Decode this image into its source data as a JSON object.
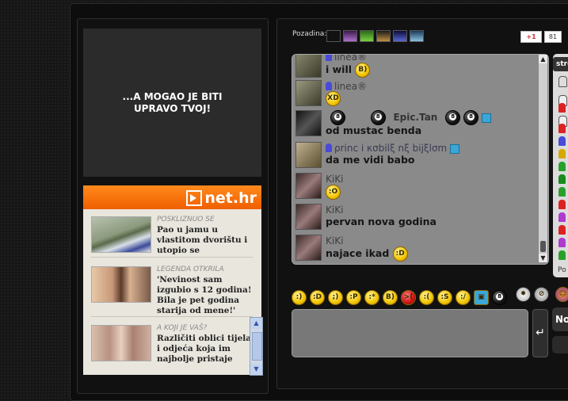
{
  "ad": {
    "text": "...A MOGAO JE BITI\nUPRAVO TVOJ!"
  },
  "news": {
    "logo": "net.hr",
    "items": [
      {
        "category": "POSKLIZNUO SE",
        "title": "Pao u jamu u vlastitom dvorištu i utopio se"
      },
      {
        "category": "LEGENDA OTKRILA",
        "title": "'Nevinost sam izgubio s 12 godina! Bila je pet godina starija od mene!'"
      },
      {
        "category": "A KOJI JE VAŠ?",
        "title": "Različiti oblici tijela i odjeća koja im najbolje pristaje"
      }
    ]
  },
  "toolbar": {
    "background_label": "Pozadina:",
    "swatches": [
      "#111111",
      "#6a3a8a",
      "#4da33a",
      "#8a6a2a",
      "#2a3a9a",
      "#3a7ab0"
    ],
    "gplus_label": "+1",
    "gplus_count": "81"
  },
  "chat": {
    "messages": [
      {
        "user": "linea®",
        "text": "i will",
        "emote": "cool"
      },
      {
        "user": "linea®",
        "text": "",
        "emote": "laugh"
      },
      {
        "user": "Epic.Tan",
        "text": "od mustac benda",
        "emote": ""
      },
      {
        "user": "ρrinc i κσbilξ nξ bijξlσm",
        "text": "da me vidi babo",
        "emote": ""
      },
      {
        "user": "KiKi",
        "text": "",
        "emote": "surprised"
      },
      {
        "user": "KiKi",
        "text": "pervan nova godina",
        "emote": ""
      },
      {
        "user": "KiKi",
        "text": "najace ikad",
        "emote": "grin"
      }
    ]
  },
  "userlist": {
    "tab_label": "stre",
    "footer_label": "Po"
  },
  "input": {
    "send_label": "↵",
    "right_label": "No"
  },
  "emoticons": [
    "smile",
    "grin",
    "wink",
    "tongue",
    "kiss",
    "cool",
    "angry",
    "sad",
    "confused",
    "frown",
    "tv",
    "eight-ball",
    "bomb",
    "no"
  ]
}
